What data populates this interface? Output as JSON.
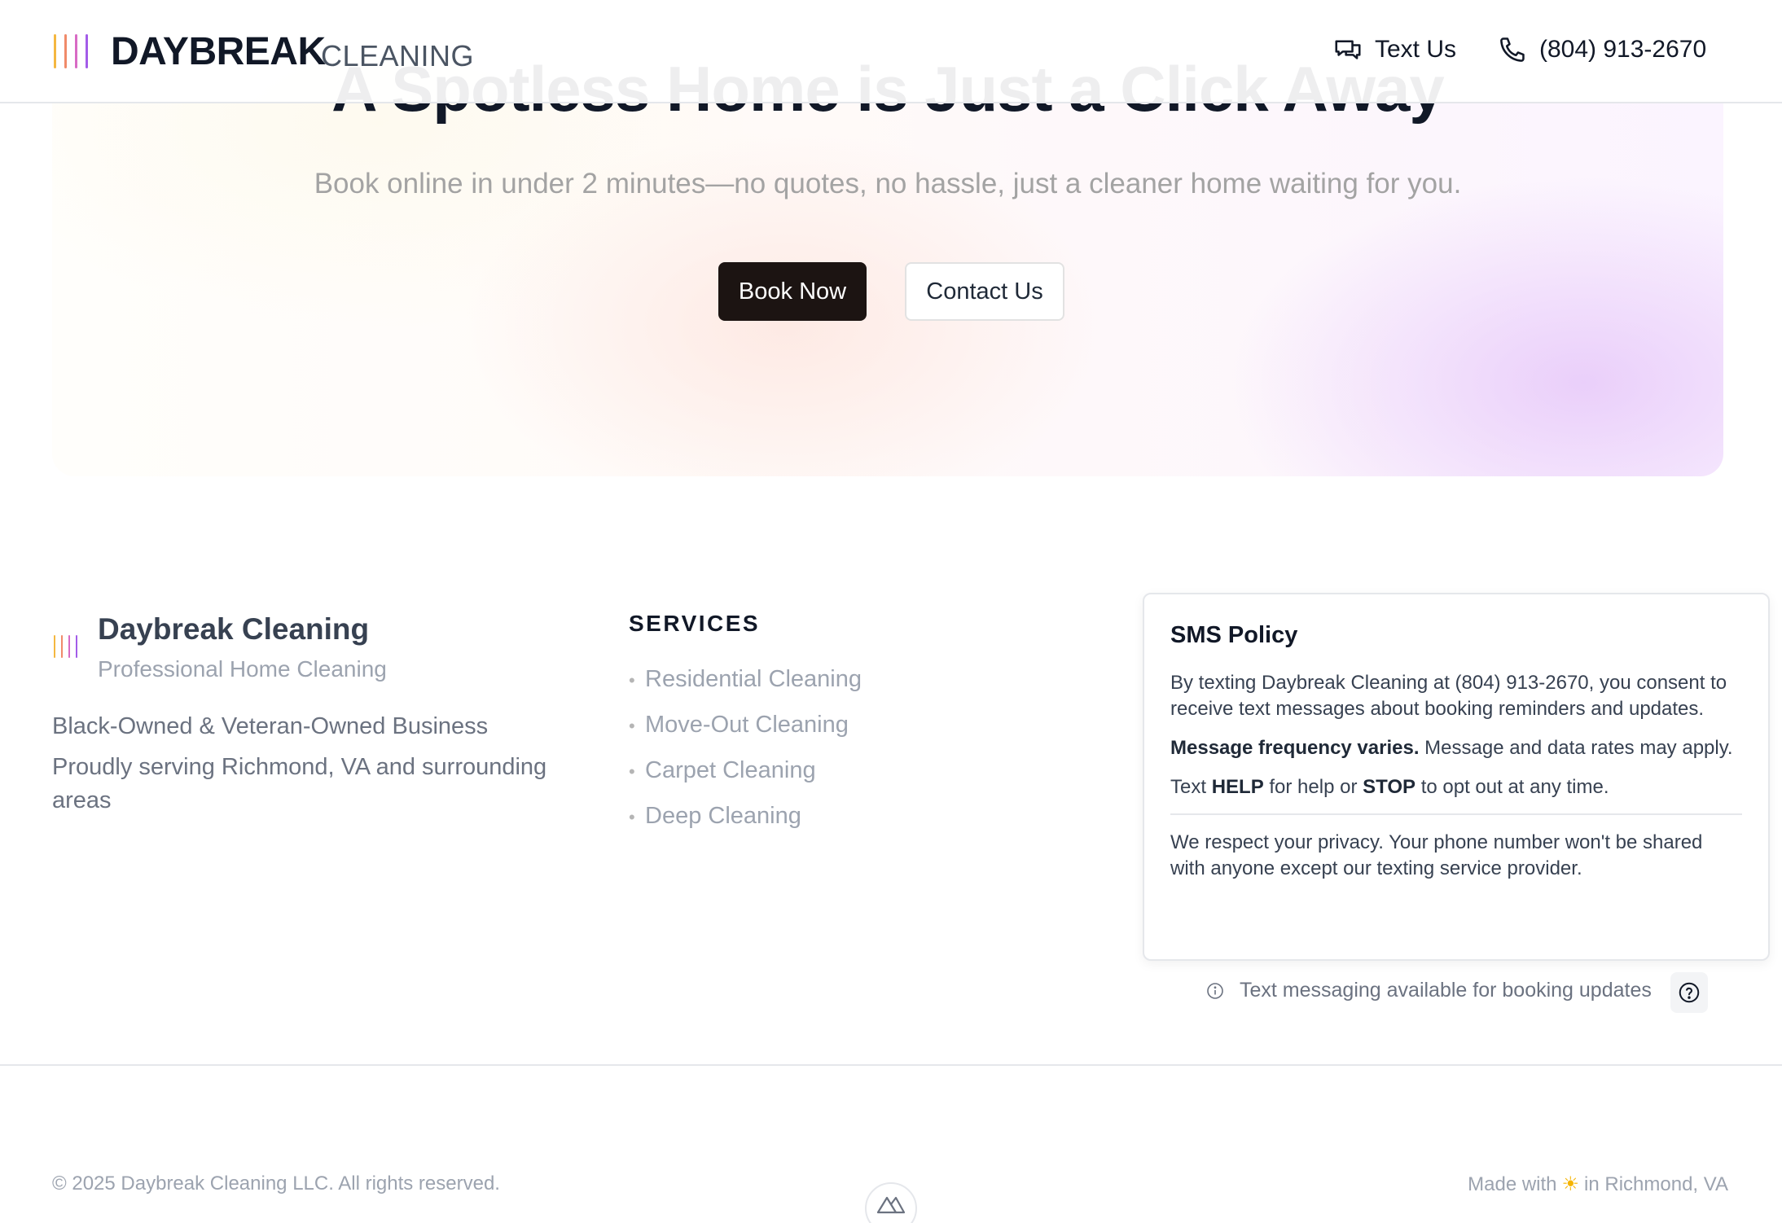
{
  "header": {
    "brand": "DAYBREAK",
    "brand_sub": "CLEANING",
    "text_us": "Text Us",
    "phone": "(804) 913-2670",
    "logo_colors": [
      "#f4b740",
      "#f08a6a",
      "#d86bc4",
      "#a35ce8"
    ]
  },
  "hero": {
    "title": "A Spotless Home is Just a Click Away",
    "subtitle": "Book online in under 2 minutes—no quotes, no hassle, just a cleaner home waiting for you.",
    "book_now": "Book Now",
    "contact_us": "Contact Us"
  },
  "footer": {
    "brand_name": "Daybreak Cleaning",
    "brand_tagline": "Professional Home Cleaning",
    "line1": "Black-Owned & Veteran-Owned Business",
    "line2": "Proudly serving Richmond, VA and surrounding areas",
    "services_heading": "SERVICES",
    "services": [
      "Residential Cleaning",
      "Move-Out Cleaning",
      "Carpet Cleaning",
      "Deep Cleaning"
    ]
  },
  "sms": {
    "title": "SMS Policy",
    "p1": "By texting Daybreak Cleaning at (804) 913-2670, you consent to receive text messages about booking reminders and updates.",
    "p2_bold": "Message frequency varies.",
    "p2_rest": " Message and data rates may apply.",
    "p3_pre": "Text ",
    "p3_help": "HELP",
    "p3_mid": " for help or ",
    "p3_stop": "STOP",
    "p3_post": " to opt out at any time.",
    "p4": "We respect your privacy. Your phone number won't be shared with anyone except our texting service provider.",
    "note": "Text messaging available for booking updates"
  },
  "bottom": {
    "copyright": "© 2025 Daybreak Cleaning LLC. All rights reserved.",
    "made_pre": "Made with",
    "made_icon": "☀",
    "made_post": "in Richmond, VA"
  }
}
